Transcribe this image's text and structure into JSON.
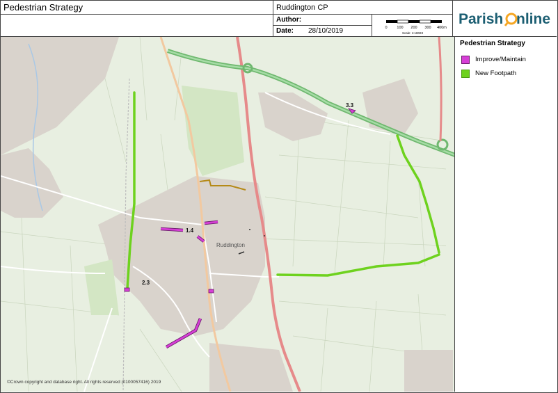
{
  "header": {
    "title": "Pedestrian Strategy",
    "parish": "Ruddington CP",
    "author_label": "Author:",
    "date_label": "Date:",
    "date_value": "28/10/2019"
  },
  "scalebar": {
    "ticks": [
      "0",
      "100",
      "200",
      "300",
      "400m"
    ],
    "scale_text": "Scale: 1:18023"
  },
  "logo": {
    "text_before": "Parish",
    "text_after": "nline",
    "accent": "#f5a623",
    "brand": "#1b5e72"
  },
  "legend": {
    "title": "Pedestrian Strategy",
    "items": [
      {
        "label": "Improve/Maintain",
        "color": "#d63fd6",
        "border": "#6a1b6a"
      },
      {
        "label": "New Footpath",
        "color": "#6ed21e",
        "border": "#4a9a10"
      }
    ]
  },
  "map": {
    "place_label": "Ruddington",
    "annotations": [
      "1.4",
      "2.3",
      "3.3"
    ]
  },
  "copyright": "©Crown copyright and database right. All rights reserved (0100057416) 2019"
}
